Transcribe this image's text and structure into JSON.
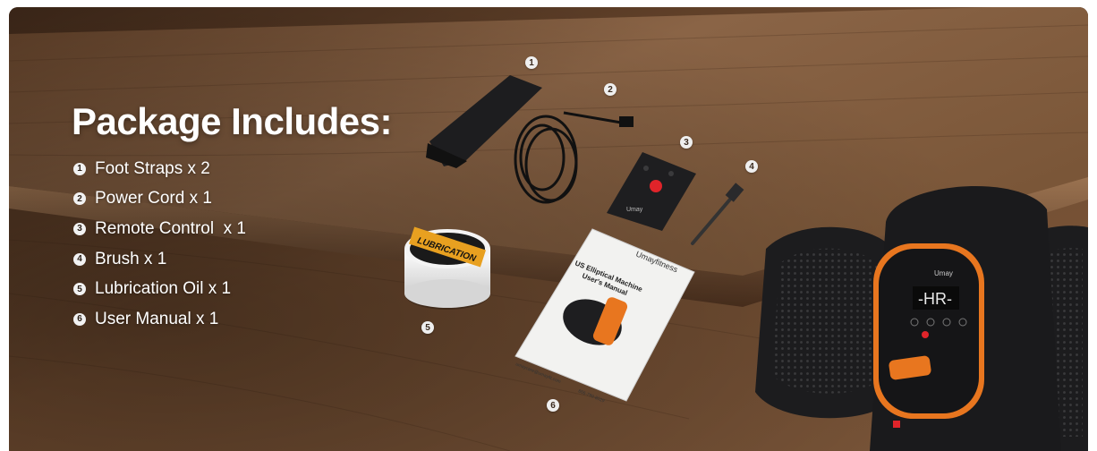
{
  "heading": "Package Includes:",
  "items": [
    {
      "num": "1",
      "label": "Foot Straps x 2"
    },
    {
      "num": "2",
      "label": "Power Cord x 1"
    },
    {
      "num": "3",
      "label": "Remote Control  x 1"
    },
    {
      "num": "4",
      "label": "Brush x 1"
    },
    {
      "num": "5",
      "label": "Lubrication Oil x 1"
    },
    {
      "num": "6",
      "label": "User Manual x 1"
    }
  ],
  "product": {
    "oil_label": "LUBRICATION",
    "remote_brand": "Umay",
    "manual_brand": "Umayfitness",
    "manual_title_1": "US Elliptical Machine",
    "manual_title_2": "User's Manual",
    "manual_email": "umaycare@umayfit.com",
    "manual_phone": "866-799-8029",
    "console_brand": "Umay",
    "console_display": "-HR-"
  },
  "colors": {
    "accent": "#e8761f",
    "wood": "#6b4a30",
    "device": "#1c1c1e"
  }
}
